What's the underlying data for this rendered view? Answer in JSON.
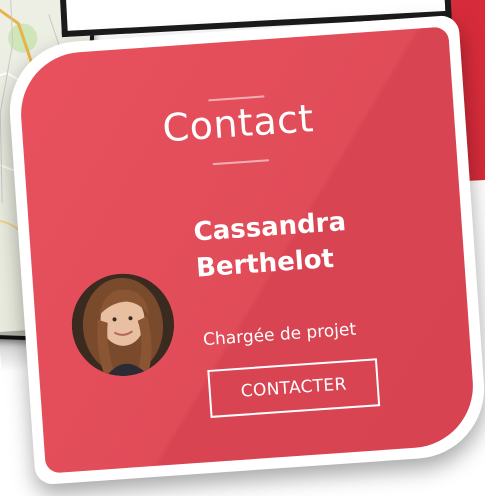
{
  "card": {
    "title": "Contact",
    "person_name_line1": "Cassandra",
    "person_name_line2": "Berthelot",
    "role": "Chargée de projet",
    "button_label": "CONTACTER",
    "avatar_alt": "Cassandra Berthelot"
  },
  "colors": {
    "card_red": "#e14c59",
    "card_border": "#ffffff",
    "text": "#ffffff"
  },
  "icons": {
    "avatar": "portrait-photo"
  }
}
